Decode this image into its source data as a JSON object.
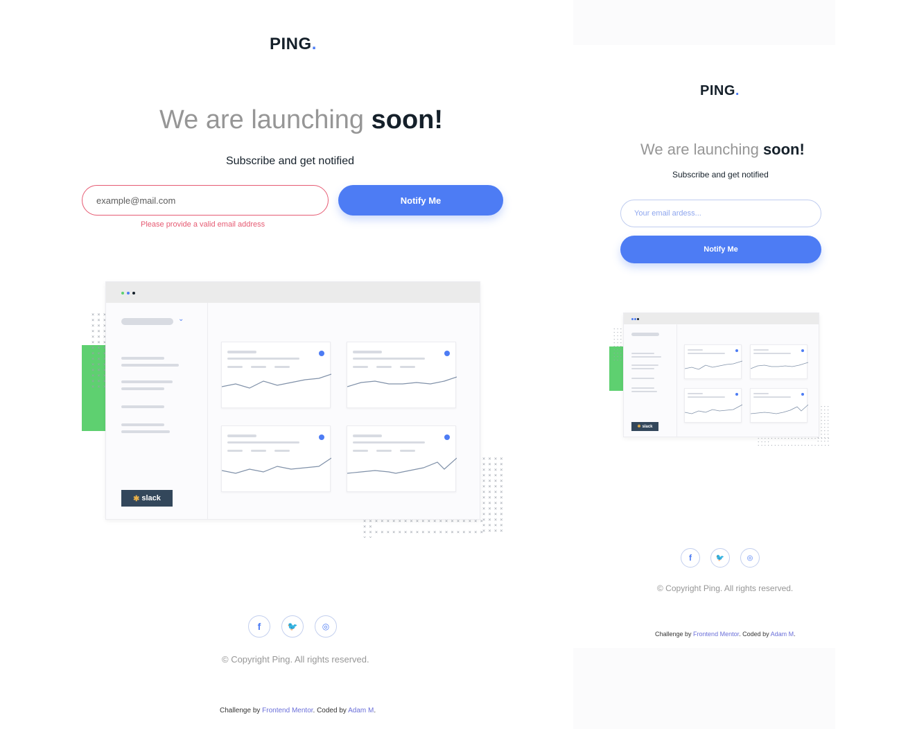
{
  "brand": {
    "name": "PING",
    "dot": "."
  },
  "hero": {
    "headline_light": "We are launching ",
    "headline_bold": "soon!",
    "subtitle": "Subscribe and get notified"
  },
  "desktop": {
    "email_value": "example@mail.com",
    "email_placeholder": "example@mail.com",
    "error": "Please provide a valid email address"
  },
  "mobile": {
    "email_placeholder": "Your email ardess..."
  },
  "notify_label": "Notify Me",
  "illustration": {
    "slack_label": "slack"
  },
  "social": [
    {
      "icon": "facebook-icon",
      "glyph": "f"
    },
    {
      "icon": "twitter-icon",
      "glyph": "t"
    },
    {
      "icon": "instagram-icon",
      "glyph": "i"
    }
  ],
  "footer": {
    "copyright": "© Copyright Ping. All rights reserved.",
    "challenge_prefix": "Challenge by ",
    "challenge_link": "Frontend Mentor",
    "coded_prefix": ". Coded by ",
    "coded_link": "Adam M",
    "suffix": "."
  },
  "colors": {
    "accent": "#4d7cf4",
    "error": "#e65a72",
    "dark": "#15202a",
    "gray": "#969696",
    "green": "#5ed070"
  }
}
